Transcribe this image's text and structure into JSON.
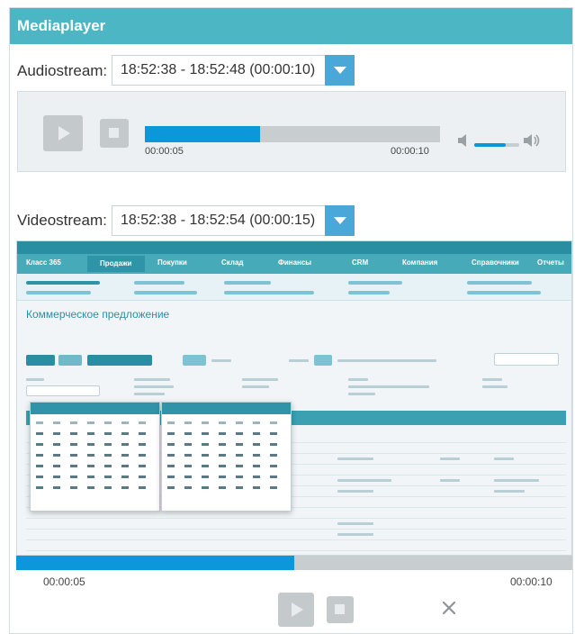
{
  "header": {
    "title": "Mediaplayer"
  },
  "audio": {
    "label": "Audiostream:",
    "selected": "18:52:38 - 18:52:48 (00:00:10)",
    "current_time": "00:00:05",
    "total_time": "00:00:10",
    "progress_fraction": 0.5,
    "volume_fraction": 0.7
  },
  "video": {
    "label": "Videostream:",
    "selected": "18:52:38 - 18:52:54 (00:00:15)",
    "current_time": "00:00:05",
    "total_time": "00:00:10",
    "progress_fraction": 0.5,
    "frame": {
      "nav_items": [
        "Класс 365",
        "Продажи",
        "Покупки",
        "Склад",
        "Финансы",
        "CRM",
        "Компания",
        "Справочники",
        "Отчеты"
      ],
      "page_title": "Коммерческое предложение"
    }
  },
  "colors": {
    "header": "#4db6c5",
    "accent": "#0b97d9",
    "dropdown": "#4aa8d8",
    "track": "#c8cdd0",
    "control": "#c4c9cc"
  },
  "icons": [
    "play-icon",
    "stop-icon",
    "volume-mute-icon",
    "volume-up-icon",
    "chevron-down-icon",
    "close-icon"
  ]
}
